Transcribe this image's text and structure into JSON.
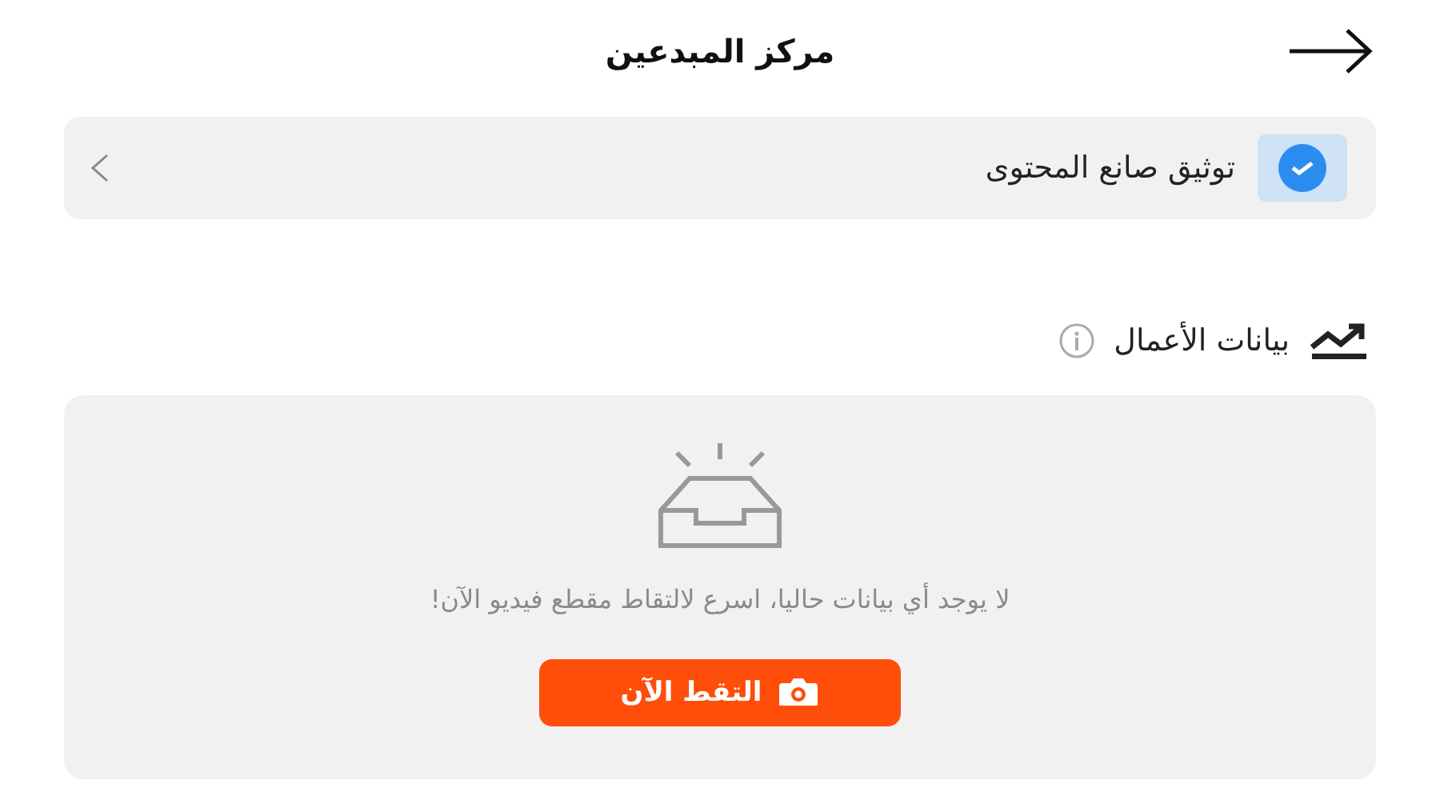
{
  "header": {
    "title": "مركز المبدعين"
  },
  "verification": {
    "label": "توثيق صانع المحتوى",
    "verified": true
  },
  "section": {
    "title": "بيانات الأعمال"
  },
  "empty_state": {
    "message": "لا يوجد أي بيانات حاليا، اسرع لالتقاط مقطع فيديو الآن!",
    "button": "التقط الآن"
  }
}
